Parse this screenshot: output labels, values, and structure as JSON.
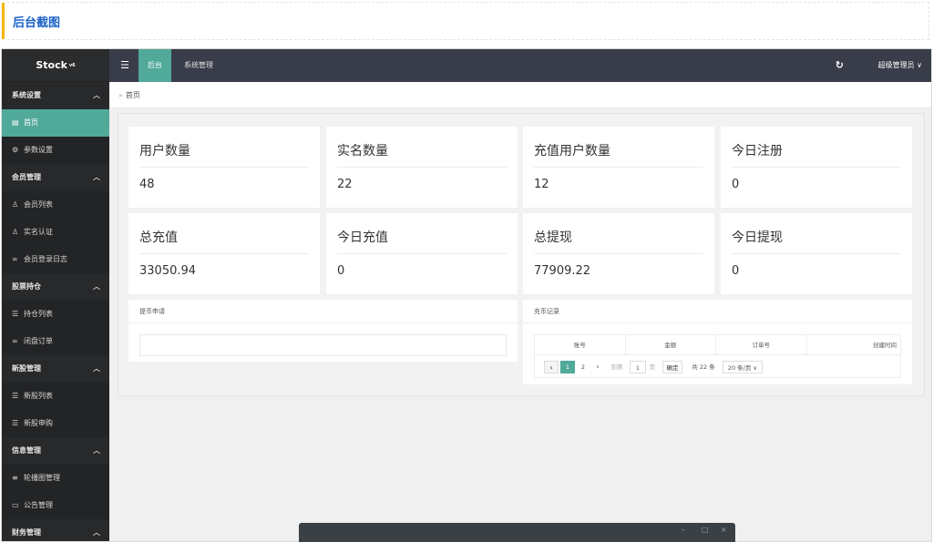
{
  "caption": {
    "title": "后台截图"
  },
  "brand": {
    "name": "Stock",
    "version": "v6"
  },
  "sidebar": {
    "items": [
      {
        "label": "系统设置",
        "type": "group",
        "icon": "chevron-up-icon"
      },
      {
        "label": "首页",
        "type": "item",
        "active": true,
        "icon": "dashboard-icon"
      },
      {
        "label": "参数设置",
        "type": "item",
        "icon": "gear-icon"
      },
      {
        "label": "会员管理",
        "type": "group",
        "icon": "chevron-up-icon"
      },
      {
        "label": "会员列表",
        "type": "item",
        "icon": "user-icon"
      },
      {
        "label": "实名认证",
        "type": "item",
        "icon": "user-icon"
      },
      {
        "label": "会员登录日志",
        "type": "item",
        "icon": "link-icon"
      },
      {
        "label": "股票持仓",
        "type": "group",
        "icon": "chevron-up-icon"
      },
      {
        "label": "持仓列表",
        "type": "item",
        "icon": "list-icon"
      },
      {
        "label": "闭盘订单",
        "type": "item",
        "icon": "link-icon"
      },
      {
        "label": "新股管理",
        "type": "group",
        "icon": "chevron-up-icon"
      },
      {
        "label": "新股列表",
        "type": "item",
        "icon": "list-icon"
      },
      {
        "label": "新股申购",
        "type": "item",
        "icon": "list-icon"
      },
      {
        "label": "信息管理",
        "type": "group",
        "icon": "chevron-up-icon"
      },
      {
        "label": "轮播图管理",
        "type": "item",
        "icon": "menu-icon"
      },
      {
        "label": "公告管理",
        "type": "item",
        "icon": "window-icon"
      },
      {
        "label": "财务管理",
        "type": "group",
        "icon": "chevron-up-icon"
      }
    ]
  },
  "topbar": {
    "tabs": [
      {
        "label": "后台"
      },
      {
        "label": "系统管理"
      }
    ],
    "user": "超级管理员 ∨"
  },
  "breadcrumb": {
    "label": "首页"
  },
  "stats": [
    {
      "label": "用户数量",
      "value": "48"
    },
    {
      "label": "实名数量",
      "value": "22"
    },
    {
      "label": "充值用户数量",
      "value": "12"
    },
    {
      "label": "今日注册",
      "value": "0"
    },
    {
      "label": "总充值",
      "value": "33050.94"
    },
    {
      "label": "今日充值",
      "value": "0"
    },
    {
      "label": "总提现",
      "value": "77909.22"
    },
    {
      "label": "今日提现",
      "value": "0"
    }
  ],
  "withdraw_card": {
    "title": "提币申请"
  },
  "recharge_card": {
    "title": "充币记录",
    "columns": [
      "账号",
      "金额",
      "订单号",
      "创建时间"
    ],
    "pager": {
      "prev": "‹",
      "pages": [
        "1",
        "2"
      ],
      "next": "›",
      "goto_label": "到第",
      "page_input": "1",
      "page_unit": "页",
      "confirm": "确定",
      "total": "共 22 条",
      "page_size": "20 条/页 ∨"
    }
  }
}
